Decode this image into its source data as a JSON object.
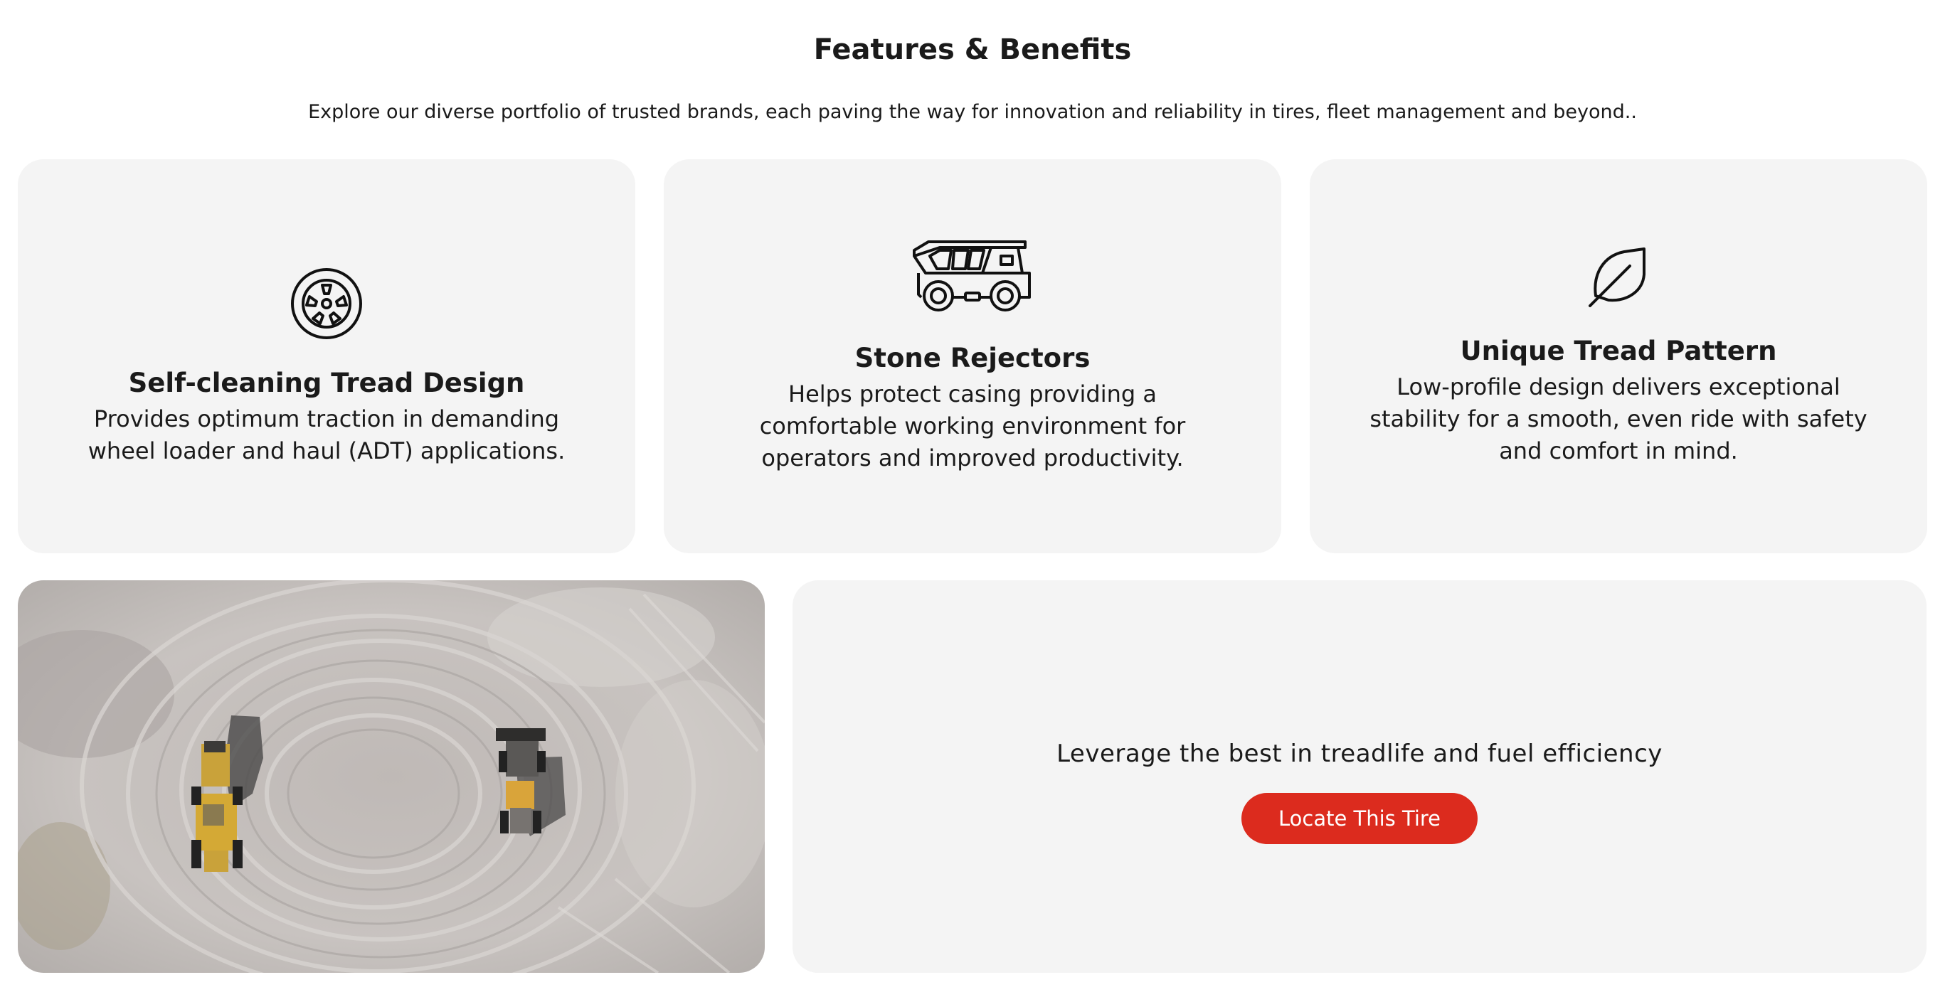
{
  "section": {
    "title": "Features & Benefits",
    "subtitle": "Explore our diverse portfolio of trusted brands, each paving the way for innovation and reliability in tires, fleet management and beyond.."
  },
  "features": [
    {
      "icon": "tire-wheel-icon",
      "title": "Self-cleaning Tread Design",
      "description": "Provides optimum traction in demanding wheel loader and haul (ADT) applications."
    },
    {
      "icon": "dump-truck-icon",
      "title": "Stone Rejectors",
      "description": "Helps protect casing providing a comfortable working environment for operators and improved productivity."
    },
    {
      "icon": "leaf-icon",
      "title": "Unique Tread Pattern",
      "description": "Low-profile design delivers exceptional stability for a smooth, even ride with safety and comfort in mind."
    }
  ],
  "photo": {
    "subject": "aerial-quarry-loaders-photo"
  },
  "cta": {
    "text": "Leverage the best in treadlife and fuel efficiency",
    "button_label": "Locate This Tire"
  },
  "colors": {
    "card_background": "#f4f4f4",
    "button_red": "#dc2b1e",
    "text_dark": "#1a1a1a"
  }
}
